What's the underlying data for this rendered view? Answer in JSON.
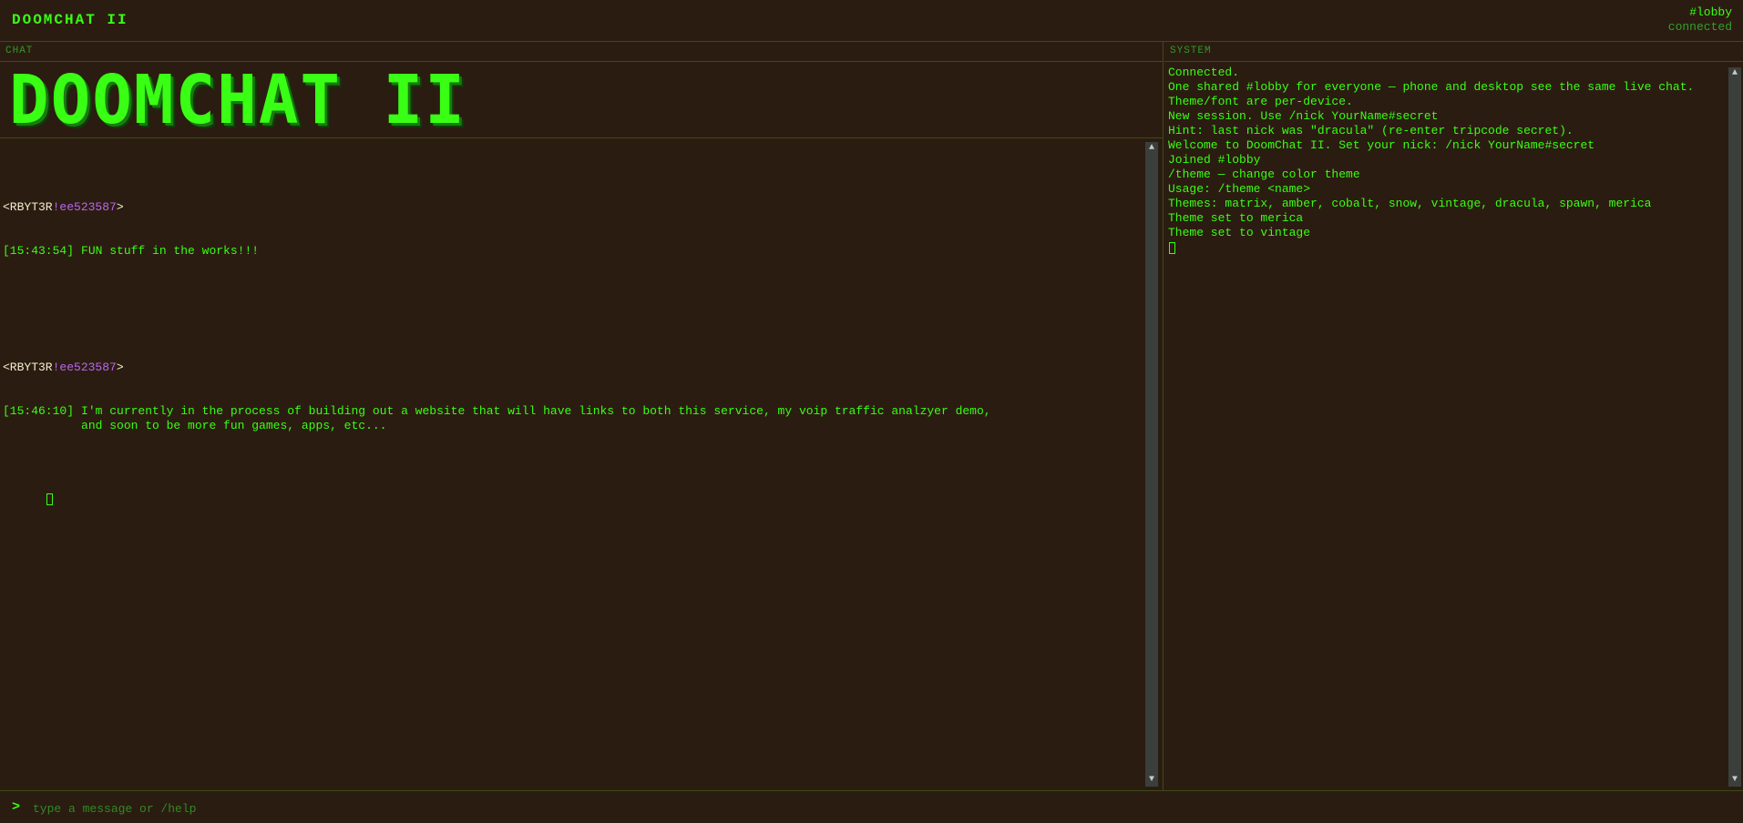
{
  "header": {
    "title": "DOOMCHAT II",
    "channel": "#lobby",
    "status": "connected"
  },
  "chat": {
    "label": "CHAT",
    "banner": "DOOMCHAT II",
    "messages": [
      {
        "nick": "<RBYT3R",
        "trip": "!ee523587",
        "nick_close": ">",
        "timestamp": "[15:43:54]",
        "text": "FUN stuff in the works!!!"
      },
      {
        "nick": "<RBYT3R",
        "trip": "!ee523587",
        "nick_close": ">",
        "timestamp": "[15:46:10]",
        "text": "I'm currently in the process of building out a website that will have links to both this service, my voip traffic analzyer demo,\nand soon to be more fun games, apps, etc..."
      }
    ]
  },
  "system": {
    "label": "SYSTEM",
    "lines": [
      "Connected.",
      "One shared #lobby for everyone — phone and desktop see the same live chat. Theme/font are per-device.",
      "New session. Use /nick YourName#secret",
      "Hint: last nick was \"dracula\" (re-enter tripcode secret).",
      "Welcome to DoomChat II. Set your nick: /nick YourName#secret",
      "Joined #lobby",
      "/theme — change color theme",
      "Usage: /theme <name>",
      "Themes: matrix, amber, cobalt, snow, vintage, dracula, spawn, merica",
      "Theme set to merica",
      "Theme set to vintage"
    ]
  },
  "input": {
    "prompt": ">",
    "placeholder": "type a message or /help",
    "value": ""
  },
  "colors": {
    "background": "#2b1c11",
    "text": "#39ff14",
    "nick": "#f2eecf",
    "trip": "#b768f0",
    "muted": "#2f9a25"
  }
}
